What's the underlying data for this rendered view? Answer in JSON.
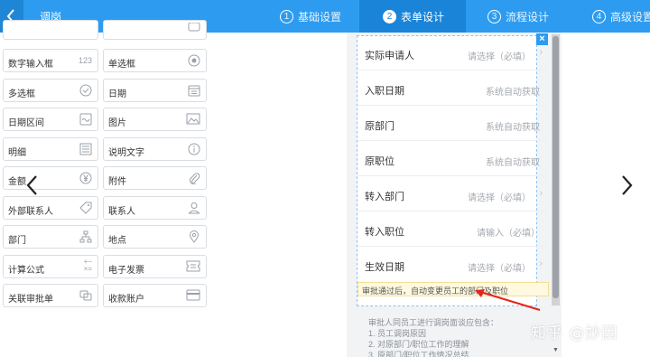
{
  "header": {
    "title": "调岗",
    "steps": [
      {
        "num": "1",
        "label": "基础设置"
      },
      {
        "num": "2",
        "label": "表单设计"
      },
      {
        "num": "3",
        "label": "流程设计"
      },
      {
        "num": "4",
        "label": "高级设置"
      }
    ],
    "active_step": 2
  },
  "palette": {
    "items": [
      {
        "label": "数字输入框",
        "icon": "123-icon",
        "icon_text": "123"
      },
      {
        "label": "单选框",
        "icon": "radio-icon"
      },
      {
        "label": "多选框",
        "icon": "check-circle-icon"
      },
      {
        "label": "日期",
        "icon": "calendar-icon"
      },
      {
        "label": "日期区间",
        "icon": "date-range-icon"
      },
      {
        "label": "图片",
        "icon": "image-icon"
      },
      {
        "label": "明细",
        "icon": "detail-icon"
      },
      {
        "label": "说明文字",
        "icon": "info-icon"
      },
      {
        "label": "金额",
        "icon": "yen-icon"
      },
      {
        "label": "附件",
        "icon": "paperclip-icon"
      },
      {
        "label": "外部联系人",
        "icon": "tag-icon"
      },
      {
        "label": "联系人",
        "icon": "person-icon"
      },
      {
        "label": "部门",
        "icon": "org-chart-icon"
      },
      {
        "label": "地点",
        "icon": "location-pin-icon"
      },
      {
        "label": "计算公式",
        "icon": "calculator-icon",
        "icon_text": "+−\n×="
      },
      {
        "label": "电子发票",
        "icon": "invoice-icon"
      },
      {
        "label": "关联审批单",
        "icon": "link-icon"
      },
      {
        "label": "收款账户",
        "icon": "card-icon"
      }
    ]
  },
  "form": {
    "close_symbol": "×",
    "rows": [
      {
        "label": "实际申请人",
        "value": "请选择（必填）",
        "chevron": "›"
      },
      {
        "label": "入职日期",
        "value": "系统自动获取",
        "chevron": ""
      },
      {
        "label": "原部门",
        "value": "系统自动获取",
        "chevron": ""
      },
      {
        "label": "原职位",
        "value": "系统自动获取",
        "chevron": ""
      },
      {
        "label": "转入部门",
        "value": "请选择（必填）",
        "chevron": "›"
      },
      {
        "label": "转入职位",
        "value": "请输入（必填）",
        "chevron": ""
      },
      {
        "label": "生效日期",
        "value": "请选择（必填）",
        "chevron": "›"
      }
    ],
    "hint": "审批通过后，自动变更员工的部门及职位",
    "description": [
      "审批人同员工进行调岗面谈应包含：",
      "1. 员工调岗原因",
      "2. 对原部门/职位工作的理解",
      "3. 原部门/职位工作情况总结"
    ]
  },
  "watermark": "知乎 @妙因",
  "colors": {
    "accent": "#2d9cf0",
    "active_step_bg": "#1a84d8",
    "annotation": "#e8231b"
  }
}
